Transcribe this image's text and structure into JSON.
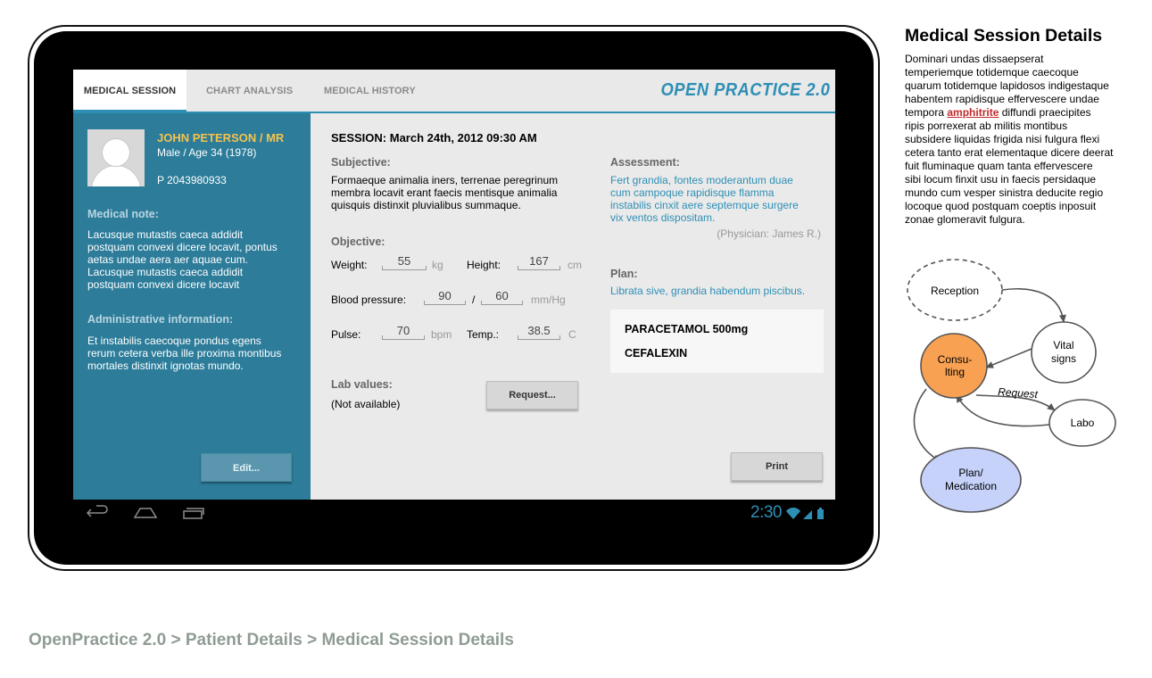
{
  "tabs": [
    {
      "label": "MEDICAL SESSION",
      "active": true
    },
    {
      "label": "CHART ANALYSIS",
      "active": false
    },
    {
      "label": "MEDICAL HISTORY",
      "active": false
    }
  ],
  "brand": "OPEN PRACTICE 2.0",
  "patient": {
    "name": "JOHN PETERSON / MR",
    "sex_age": "Male / Age 34 (1978)",
    "phone": "P 2043980933",
    "medical_note_heading": "Medical note:",
    "medical_note": [
      "Lacusque mutastis caeca addidit",
      "postquam convexi dicere locavit, pontus",
      "aetas undae aera aer aquae cum.",
      "Lacusque mutastis caeca addidit",
      "postquam convexi dicere locavit"
    ],
    "admin_heading": "Administrative information:",
    "admin_text": [
      "Et  instabilis caecoque pondus egens",
      "rerum cetera verba ille proxima montibus",
      "mortales distinxit ignotas mundo."
    ],
    "edit_label": "Edit..."
  },
  "session": {
    "title": "SESSION: March 24th, 2012 09:30 AM",
    "subjective_heading": "Subjective:",
    "subjective_text": [
      "Formaeque animalia iners, terrenae peregrinum",
      "membra locavit erant faecis mentisque animalia",
      "quisquis distinxit pluvialibus summaque."
    ],
    "objective_heading": "Objective:",
    "weight_label": "Weight:",
    "weight_value": "55",
    "weight_unit": "kg",
    "height_label": "Height:",
    "height_value": "167",
    "height_unit": "cm",
    "bp_label": "Blood pressure:",
    "bp_sys": "90",
    "bp_sep": "/",
    "bp_dia": "60",
    "bp_unit": "mm/Hg",
    "pulse_label": "Pulse:",
    "pulse_value": "70",
    "pulse_unit": "bpm",
    "temp_label": "Temp.:",
    "temp_value": "38.5",
    "temp_unit": "C",
    "lab_heading": "Lab values:",
    "lab_value": "(Not available)",
    "request_label": "Request...",
    "assessment_heading": "Assessment:",
    "assessment_text": [
      "Fert grandia, fontes moderantum duae",
      "cum campoque rapidisque flamma",
      "instabilis cinxit aere septemque surgere",
      "vix ventos dispositam."
    ],
    "physician": "(Physician: James R.)",
    "plan_heading": "Plan:",
    "plan_text": "Librata sive, grandia habendum piscibus.",
    "medications": [
      "PARACETAMOL 500mg",
      "CEFALEXIN"
    ],
    "print_label": "Print"
  },
  "statusbar": {
    "time": "2:30"
  },
  "panel": {
    "title": "Medical Session Details",
    "para_lines": [
      "Dominari undas dissaepserat",
      "temperiemque totidemque caecoque",
      "quarum totidemque lapidosos indigestaque",
      "habentem rapidisque effervescere undae"
    ],
    "para_pre_link": "tempora ",
    "para_link": "amphitrite",
    "para_post_link": " diffundi praecipites",
    "para_lines2": [
      "ripis porrexerat ab militis montibus",
      "subsidere liquidas frigida nisi fulgura flexi",
      "cetera tanto erat elementaque dicere deerat",
      "fuit fluminaque quam tanta effervescere",
      "sibi locum finxit usu in faecis persidaque",
      "mundo cum vesper sinistra deducite regio",
      "locoque quod postquam coeptis inposuit",
      "zonae glomeravit fulgura."
    ]
  },
  "diagram": {
    "nodes": {
      "reception": "Reception",
      "vital1": "Vital",
      "vital2": "signs",
      "consult1": "Consu-",
      "consult2": "lting",
      "labo": "Labo",
      "plan1": "Plan/",
      "plan2": "Medication"
    },
    "edge_label": "Request",
    "colors": {
      "consulting": "#f9a153",
      "plan": "#c6d2fa"
    }
  },
  "breadcrumb": [
    "OpenPractice 2.0",
    "Patient Details",
    "Medical Session Details"
  ],
  "breadcrumb_sep": ">"
}
